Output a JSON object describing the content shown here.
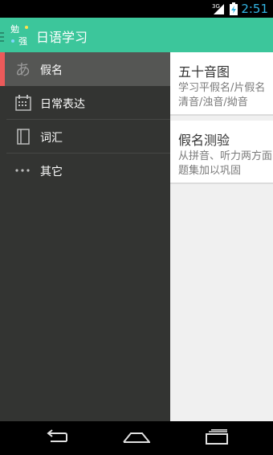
{
  "status_bar": {
    "time": "2:51",
    "network": "3G"
  },
  "action_bar": {
    "title": "日语学习",
    "logo_text": "勉强"
  },
  "drawer": {
    "items": [
      {
        "label": "假名",
        "icon": "hiragana-a-icon",
        "icon_glyph": "あ",
        "selected": true
      },
      {
        "label": "日常表达",
        "icon": "calendar-icon",
        "selected": false
      },
      {
        "label": "词汇",
        "icon": "book-icon",
        "selected": false
      },
      {
        "label": "其它",
        "icon": "more-dots-icon",
        "selected": false
      }
    ]
  },
  "content": {
    "cards": [
      {
        "title": "五十音图",
        "subtitle_line1": "学习平假名/片假名",
        "subtitle_line2": "清音/浊音/拗音"
      },
      {
        "title": "假名测验",
        "subtitle_line1": "从拼音、听力两方面",
        "subtitle_line2": "题集加以巩固"
      }
    ]
  },
  "colors": {
    "action_bar": "#3cc69b",
    "drawer_bg": "#333432",
    "drawer_selected": "#555654",
    "accent": "#ec5a5a",
    "status_time": "#33b5e5"
  }
}
